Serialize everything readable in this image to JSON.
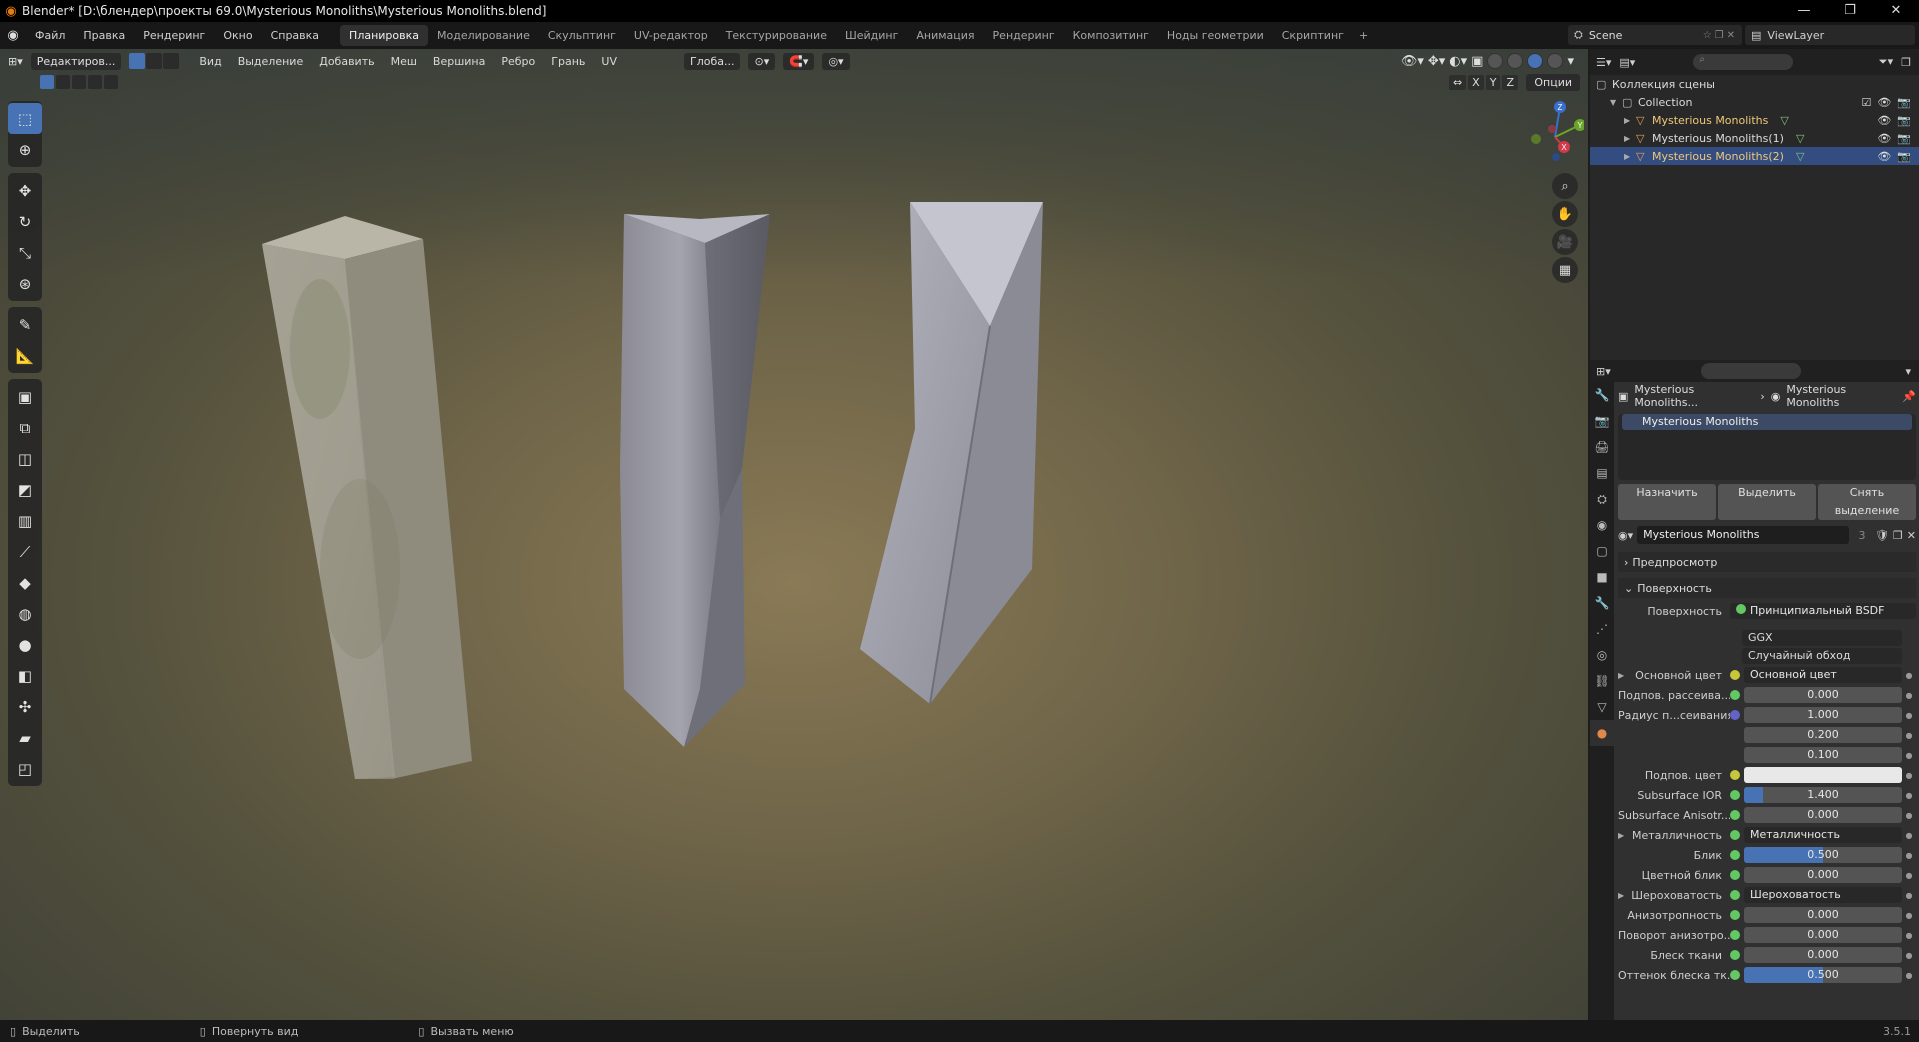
{
  "titlebar": {
    "title": "Blender* [D:\\блендер\\проекты 69.0\\Mysterious Monoliths\\Mysterious Monoliths.blend]",
    "min": "—",
    "max": "❐",
    "close": "✕"
  },
  "menus": [
    "Файл",
    "Правка",
    "Рендеринг",
    "Окно",
    "Справка"
  ],
  "workspaces": [
    {
      "label": "Планировка",
      "active": true
    },
    {
      "label": "Моделирование"
    },
    {
      "label": "Скульптинг"
    },
    {
      "label": "UV-редактор"
    },
    {
      "label": "Текстурирование"
    },
    {
      "label": "Шейдинг"
    },
    {
      "label": "Анимация"
    },
    {
      "label": "Рендеринг"
    },
    {
      "label": "Композитинг"
    },
    {
      "label": "Ноды геометрии"
    },
    {
      "label": "Скриптинг"
    }
  ],
  "workspace_add": "+",
  "scene": {
    "label": "Scene"
  },
  "viewlayer": {
    "label": "ViewLayer"
  },
  "viewport": {
    "mode": "Редактиров...",
    "menus": [
      "Вид",
      "Выделение",
      "Добавить",
      "Меш",
      "Вершина",
      "Ребро",
      "Грань",
      "UV"
    ],
    "orientation": "Глоба...",
    "axes": [
      "X",
      "Y",
      "Z"
    ],
    "options": "Опции"
  },
  "gizmo": {
    "x": "X",
    "y": "Y",
    "z": "Z"
  },
  "outliner": {
    "scene_collection": "Коллекция сцены",
    "collection": "Collection",
    "objects": [
      {
        "name": "Mysterious Monoliths",
        "selected": false
      },
      {
        "name": "Mysterious Monoliths(1)",
        "selected": false
      },
      {
        "name": "Mysterious Monoliths(2)",
        "selected": true
      }
    ]
  },
  "properties": {
    "breadcrumb_obj": "Mysterious Monoliths...",
    "breadcrumb_mat": "Mysterious Monoliths",
    "slot_name": "Mysterious Monoliths",
    "buttons": {
      "assign": "Назначить",
      "select": "Выделить",
      "deselect": "Снять выделение"
    },
    "material_name": "Mysterious Monoliths",
    "material_users": "3",
    "panel_preview": "Предпросмотр",
    "panel_surface": "Поверхность",
    "surface_label": "Поверхность",
    "surface_value": "Принципиальный BSDF",
    "distribution": "GGX",
    "subsurface_method": "Случайный обход",
    "rows": [
      {
        "label": "Основной цвет",
        "value": "Основной цвет",
        "kind": "link",
        "dot": "y",
        "tri": true
      },
      {
        "label": "Подпов. рассеива...",
        "value": "0.000",
        "kind": "num",
        "dot": "g"
      },
      {
        "label": "Радиус п...сеивания",
        "value": "1.000",
        "kind": "num",
        "dot": "p"
      },
      {
        "label": "",
        "value": "0.200",
        "kind": "num",
        "dot": "none"
      },
      {
        "label": "",
        "value": "0.100",
        "kind": "num",
        "dot": "none"
      },
      {
        "label": "Подпов. цвет",
        "value": "",
        "kind": "white",
        "dot": "y"
      },
      {
        "label": "Subsurface IOR",
        "value": "1.400",
        "kind": "num",
        "dot": "g",
        "fill": 0.12
      },
      {
        "label": "Subsurface Anisotr...",
        "value": "0.000",
        "kind": "num",
        "dot": "g"
      },
      {
        "label": "Металличность",
        "value": "Металличность",
        "kind": "link",
        "dot": "g",
        "tri": true
      },
      {
        "label": "Блик",
        "value": "0.500",
        "kind": "num",
        "dot": "g",
        "fill": 0.5
      },
      {
        "label": "Цветной блик",
        "value": "0.000",
        "kind": "num",
        "dot": "g"
      },
      {
        "label": "Шероховатость",
        "value": "Шероховатость",
        "kind": "link",
        "dot": "g",
        "tri": true
      },
      {
        "label": "Анизотропность",
        "value": "0.000",
        "kind": "num",
        "dot": "g"
      },
      {
        "label": "Поворот анизотро...",
        "value": "0.000",
        "kind": "num",
        "dot": "g"
      },
      {
        "label": "Блеск ткани",
        "value": "0.000",
        "kind": "num",
        "dot": "g"
      },
      {
        "label": "Оттенок блеска тк...",
        "value": "0.500",
        "kind": "num",
        "dot": "g",
        "fill": 0.5
      }
    ]
  },
  "statusbar": {
    "select": "Выделить",
    "rotate": "Повернуть вид",
    "menu": "Вызвать меню",
    "version": "3.5.1"
  }
}
